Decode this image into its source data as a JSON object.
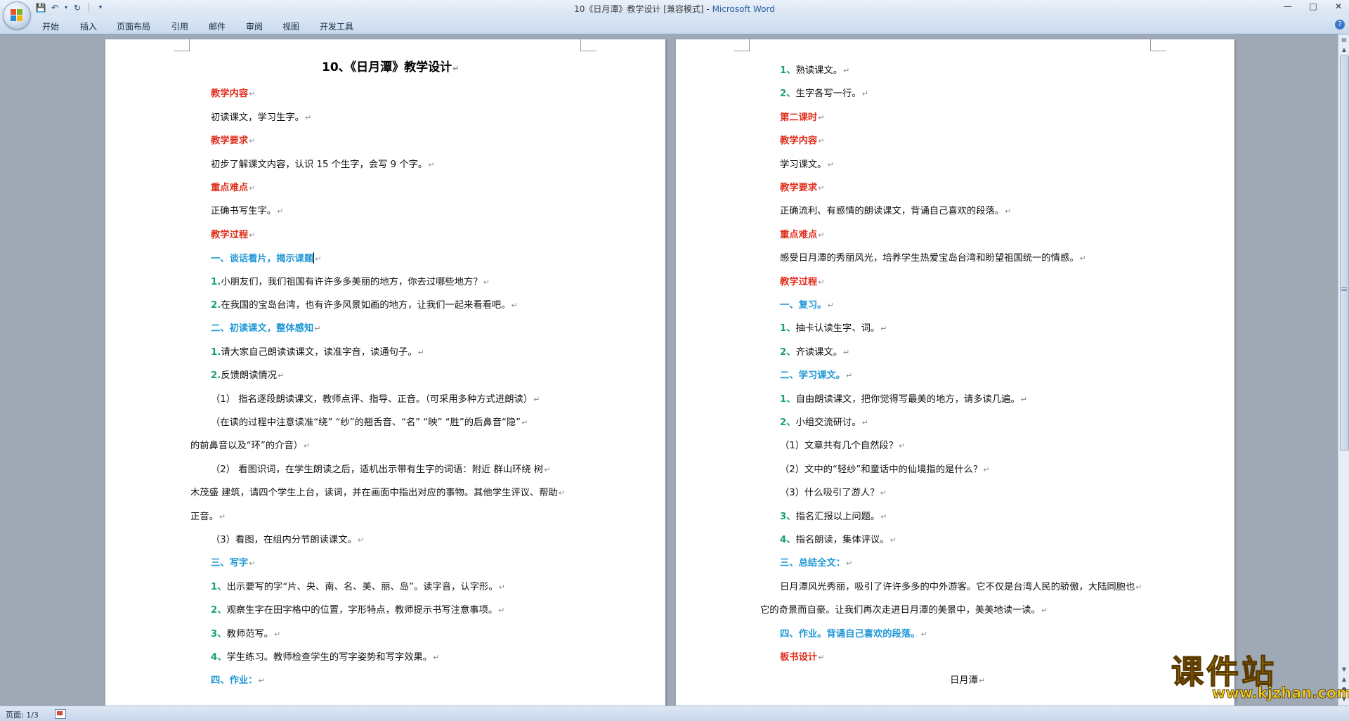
{
  "window": {
    "title": "10《日月潭》教学设计 [兼容模式] - ",
    "app_name": "Microsoft Word",
    "accent": "#2c5fa3"
  },
  "quick_access": {
    "save_icon": "save-icon",
    "undo_icon": "undo-icon",
    "redo_icon": "redo-icon",
    "customize_icon": "customize-icon"
  },
  "ribbon": {
    "tabs": [
      "开始",
      "插入",
      "页面布局",
      "引用",
      "邮件",
      "审阅",
      "视图",
      "开发工具"
    ]
  },
  "document": {
    "page_left": [
      {
        "text": "10、《日月潭》教学设计",
        "style": "title"
      },
      {
        "text": "教学内容",
        "style": "red"
      },
      {
        "text": "初读课文，学习生字。",
        "style": "normal"
      },
      {
        "text": "教学要求",
        "style": "red"
      },
      {
        "text": "初步了解课文内容，认识 15 个生字，会写 9 个字。",
        "style": "normal"
      },
      {
        "text": "重点难点",
        "style": "red"
      },
      {
        "text": "正确书写生字。",
        "style": "normal"
      },
      {
        "text": "教学过程",
        "style": "red"
      },
      {
        "text": "一、谈话看片，揭示课题",
        "style": "blue"
      },
      {
        "num": "1.",
        "text": "小朋友们，我们祖国有许许多多美丽的地方，你去过哪些地方？",
        "style": "numbered"
      },
      {
        "num": "2.",
        "text": "在我国的宝岛台湾，也有许多风景如画的地方，让我们一起来看看吧。",
        "style": "numbered"
      },
      {
        "text": "二、初读课文，整体感知",
        "style": "blue"
      },
      {
        "num": "1.",
        "text": "请大家自己朗读读课文，读准字音，读通句子。",
        "style": "numbered"
      },
      {
        "num": "2.",
        "text": "反馈朗读情况",
        "style": "numbered"
      },
      {
        "text": "（1） 指名逐段朗读课文，教师点评、指导、正音。（可采用多种方式进朗读）",
        "style": "normal"
      },
      {
        "text": "（在读的过程中注意读准“绕” “纱”的翘舌音、“名” “映” “胜”的后鼻音“隐”",
        "style": "normal"
      },
      {
        "text": "的前鼻音以及“环”的介音）",
        "style": "flush"
      },
      {
        "text": "（2） 看图识词，在学生朗读之后，适机出示带有生字的词语：附近   群山环绕   树",
        "style": "normal"
      },
      {
        "text": "木茂盛   建筑，请四个学生上台，读词，并在画面中指出对应的事物。其他学生评议、帮助",
        "style": "flush"
      },
      {
        "text": "正音。",
        "style": "flush"
      },
      {
        "text": "（3）看图，在组内分节朗读课文。",
        "style": "normal"
      },
      {
        "text": "三、写字",
        "style": "blue"
      },
      {
        "num": "1、",
        "text": "出示要写的字“片、央、南、名、美、丽、岛”。读字音，认字形。",
        "style": "numbered"
      },
      {
        "num": "2、",
        "text": "观察生字在田字格中的位置，字形特点，教师提示书写注意事项。",
        "style": "numbered"
      },
      {
        "num": "3、",
        "text": "教师范写。",
        "style": "numbered"
      },
      {
        "num": "4、",
        "text": "学生练习。教师检查学生的写字姿势和写字效果。",
        "style": "numbered"
      },
      {
        "text": "四、作业：",
        "style": "blue"
      }
    ],
    "page_right": [
      {
        "num": "1、",
        "text": "熟读课文。",
        "style": "numbered"
      },
      {
        "num": "2、",
        "text": "生字各写一行。",
        "style": "numbered"
      },
      {
        "text": "第二课时",
        "style": "red"
      },
      {
        "text": "教学内容",
        "style": "red"
      },
      {
        "text": "学习课文。",
        "style": "normal"
      },
      {
        "text": "教学要求",
        "style": "red"
      },
      {
        "text": "正确流利、有感情的朗读课文，背诵自己喜欢的段落。",
        "style": "normal"
      },
      {
        "text": "重点难点",
        "style": "red"
      },
      {
        "text": "感受日月潭的秀丽风光，培养学生热爱宝岛台湾和盼望祖国统一的情感。",
        "style": "normal"
      },
      {
        "text": "教学过程",
        "style": "red"
      },
      {
        "text": "一、复习。",
        "style": "blue"
      },
      {
        "num": "1、",
        "text": "抽卡认读生字、词。",
        "style": "numbered"
      },
      {
        "num": "2、",
        "text": "齐读课文。",
        "style": "numbered"
      },
      {
        "text": "二、学习课文。",
        "style": "blue"
      },
      {
        "num": "1、",
        "text": "自由朗读课文，把你觉得写最美的地方，请多读几遍。",
        "style": "numbered"
      },
      {
        "num": "2、",
        "text": "小组交流研讨。",
        "style": "numbered"
      },
      {
        "text": "（1）文章共有几个自然段？",
        "style": "normal"
      },
      {
        "text": "（2）文中的“轻纱”和童话中的仙境指的是什么？",
        "style": "normal"
      },
      {
        "text": "（3）什么吸引了游人？",
        "style": "normal"
      },
      {
        "num": "3、",
        "text": "指名汇报以上问题。",
        "style": "numbered"
      },
      {
        "num": "4、",
        "text": "指名朗读，集体评议。",
        "style": "numbered"
      },
      {
        "text": "三、总结全文：",
        "style": "blue"
      },
      {
        "text": "日月潭风光秀丽，吸引了许许多多的中外游客。它不仅是台湾人民的骄傲，大陆同胞也",
        "style": "normal"
      },
      {
        "text": "它的奇景而自豪。让我们再次走进日月潭的美景中，美美地读一读。",
        "style": "flush"
      },
      {
        "text": "四、作业。背诵自己喜欢的段落。",
        "style": "blue"
      },
      {
        "text": "板书设计",
        "style": "red"
      },
      {
        "text": "日月潭",
        "style": "center"
      }
    ],
    "colors": {
      "heading_red": "#e0301e",
      "heading_blue": "#1f97d6",
      "number_green": "#19a26a"
    }
  },
  "status": {
    "page": "页面: 1/3"
  },
  "watermark": {
    "name": "课件站",
    "url": "www.kjzhan.com"
  }
}
